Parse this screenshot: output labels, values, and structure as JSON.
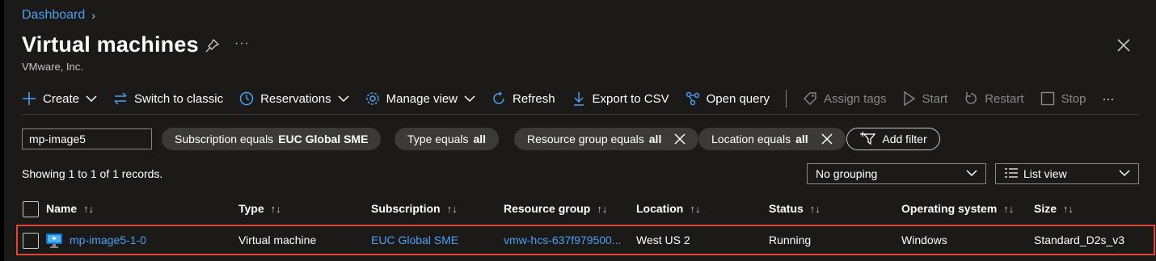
{
  "breadcrumb": {
    "root": "Dashboard"
  },
  "header": {
    "title": "Virtual machines",
    "subtitle": "VMware, Inc.",
    "more": "···"
  },
  "toolbar": {
    "create": "Create",
    "switch_classic": "Switch to classic",
    "reservations": "Reservations",
    "manage_view": "Manage view",
    "refresh": "Refresh",
    "export_csv": "Export to CSV",
    "open_query": "Open query",
    "assign_tags": "Assign tags",
    "start": "Start",
    "restart": "Restart",
    "stop": "Stop",
    "more": "···"
  },
  "filters": {
    "search_value": "mp-image5",
    "subscription": {
      "label": "Subscription equals",
      "value": "EUC Global SME"
    },
    "type": {
      "label": "Type equals",
      "value": "all"
    },
    "resource_group": {
      "label": "Resource group equals",
      "value": "all"
    },
    "location": {
      "label": "Location equals",
      "value": "all"
    },
    "add_filter": "Add filter"
  },
  "records_text": "Showing 1 to 1 of 1 records.",
  "grouping": {
    "selected": "No grouping"
  },
  "view": {
    "selected": "List view"
  },
  "table": {
    "columns": [
      "Name",
      "Type",
      "Subscription",
      "Resource group",
      "Location",
      "Status",
      "Operating system",
      "Size"
    ],
    "sort_glyph": "↑↓",
    "rows": [
      {
        "name": "mp-image5-1-0",
        "type": "Virtual machine",
        "subscription": "EUC Global SME",
        "resource_group": "vmw-hcs-637f979500...",
        "location": "West US 2",
        "status": "Running",
        "os": "Windows",
        "size": "Standard_D2s_v3"
      }
    ]
  },
  "colors": {
    "accent": "#4aa0f0",
    "highlight": "#e0453a",
    "background": "#1b1a19"
  }
}
